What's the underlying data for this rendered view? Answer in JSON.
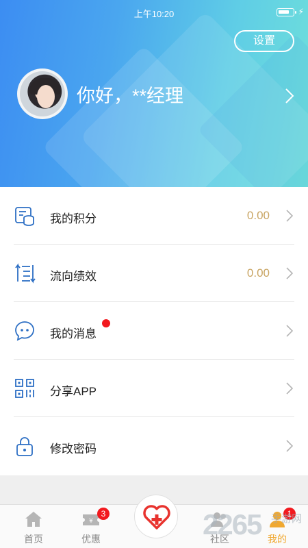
{
  "status_bar": {
    "time": "上午10:20"
  },
  "header": {
    "settings_label": "设置",
    "greeting": "你好，**经理"
  },
  "menu": [
    {
      "label": "我的积分",
      "value": "0.00",
      "icon": "coins-list-icon"
    },
    {
      "label": "流向绩效",
      "value": "0.00",
      "icon": "flow-list-icon"
    },
    {
      "label": "我的消息",
      "value": "",
      "icon": "message-bubble-icon",
      "has_dot": true
    },
    {
      "label": "分享APP",
      "value": "",
      "icon": "qr-code-icon"
    },
    {
      "label": "修改密码",
      "value": "",
      "icon": "lock-icon"
    }
  ],
  "tabbar": {
    "tabs": [
      {
        "label": "首页",
        "icon": "home-icon"
      },
      {
        "label": "优惠",
        "icon": "coupon-icon",
        "badge": "3"
      },
      {
        "label": "社区",
        "icon": "community-icon"
      },
      {
        "label": "我的",
        "icon": "profile-icon",
        "badge": "1",
        "active": true
      }
    ]
  },
  "watermark": {
    "text": "2265",
    "sub": "手游网"
  },
  "colors": {
    "accent_value": "#c9a563",
    "active_tab": "#f0a830",
    "badge": "#f2191e",
    "icon_blue": "#2d6fc4",
    "heart_red": "#e8332e"
  }
}
